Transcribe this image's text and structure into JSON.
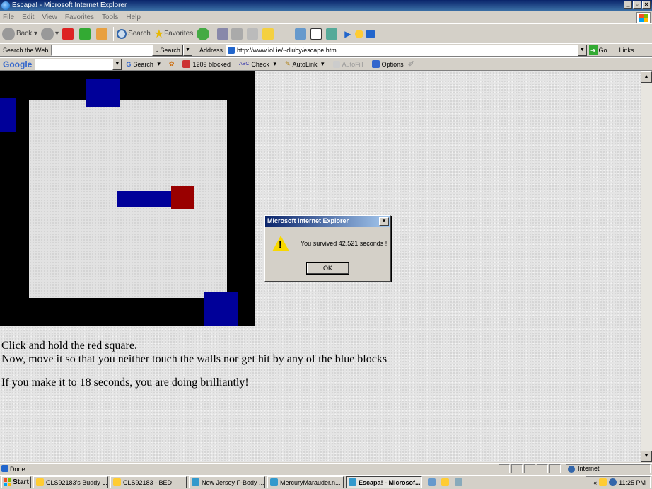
{
  "window": {
    "title": "Escapa! - Microsoft Internet Explorer",
    "controls": [
      "_",
      "×"
    ]
  },
  "menu": [
    "File",
    "Edit",
    "View",
    "Favorites",
    "Tools",
    "Help"
  ],
  "toolbar": {
    "back": "Back",
    "search": "Search",
    "favorites": "Favorites"
  },
  "addressbar": {
    "search_web_label": "Search the Web",
    "search_button": "Search",
    "address_label": "Address",
    "url": "http://www.iol.ie/~dluby/escape.htm",
    "go": "Go",
    "links": "Links"
  },
  "googlebar": {
    "brand": "Google",
    "search": "Search",
    "blocked": "1209 blocked",
    "check": "Check",
    "autolink": "AutoLink",
    "autofill": "AutoFill",
    "options": "Options"
  },
  "page": {
    "line1": "Click and hold the red square.",
    "line2": "Now, move it so that you neither touch the walls nor get hit by any of the blue blocks",
    "line3": "If you make it to 18 seconds, you are doing brilliantly!"
  },
  "dialog": {
    "title": "Microsoft Internet Explorer",
    "message": "You survived 42.521 seconds !",
    "ok": "OK"
  },
  "status": {
    "text": "Done",
    "zone": "Internet"
  },
  "taskbar": {
    "start": "Start",
    "tasks": [
      "CLS92183's Buddy L...",
      "CLS92183 - BED",
      "New Jersey F-Body ...",
      "MercuryMarauder.n...",
      "Escapa! - Microsof..."
    ],
    "tray_arrows": "«",
    "clock": "11:25 PM"
  },
  "colors": {
    "wall": "#000000",
    "blue_block": "#000099",
    "red_square": "#990000"
  }
}
